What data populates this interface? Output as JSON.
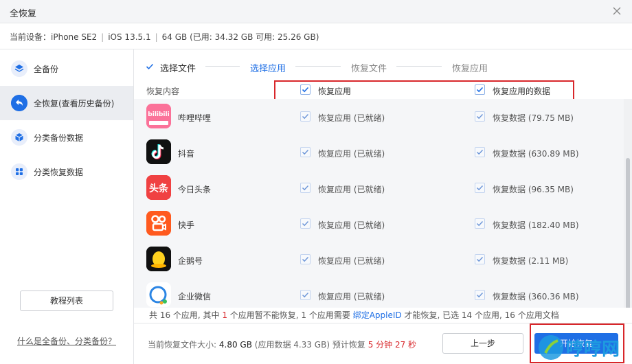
{
  "window": {
    "title": "全恢复"
  },
  "device": {
    "label": "当前设备：",
    "model": "iPhone SE2",
    "ios": "iOS 13.5.1",
    "storage": "64 GB (已用: 34.32 GB 可用: 25.26 GB)"
  },
  "sidebar": {
    "items": [
      {
        "label": "全备份",
        "icon": "layers-icon"
      },
      {
        "label": "全恢复(查看历史备份)",
        "icon": "restore-icon"
      },
      {
        "label": "分类备份数据",
        "icon": "cube-icon"
      },
      {
        "label": "分类恢复数据",
        "icon": "grid-icon"
      }
    ],
    "tutorial_button": "教程列表",
    "help_link": "什么是全备份、分类备份？"
  },
  "steps": [
    {
      "label": "选择文件",
      "state": "done"
    },
    {
      "label": "选择应用",
      "state": "current"
    },
    {
      "label": "恢复文件",
      "state": "todo"
    },
    {
      "label": "恢复应用",
      "state": "todo"
    }
  ],
  "table": {
    "header": {
      "content_label": "恢复内容",
      "col_app": "恢复应用",
      "col_data": "恢复应用的数据"
    },
    "rows": [
      {
        "name": "哔哩哔哩",
        "app_status": "恢复应用 (已就绪)",
        "data_status": "恢复数据 (79.75 MB)",
        "icon": "bilibili-icon"
      },
      {
        "name": "抖音",
        "app_status": "恢复应用 (已就绪)",
        "data_status": "恢复数据 (630.89 MB)",
        "icon": "douyin-icon"
      },
      {
        "name": "今日头条",
        "app_status": "恢复应用 (已就绪)",
        "data_status": "恢复数据 (96.35 MB)",
        "icon": "toutiao-icon"
      },
      {
        "name": "快手",
        "app_status": "恢复应用 (已就绪)",
        "data_status": "恢复数据 (182.40 MB)",
        "icon": "kuaishou-icon"
      },
      {
        "name": "企鹅号",
        "app_status": "恢复应用 (已就绪)",
        "data_status": "恢复数据 (2.11 MB)",
        "icon": "penguin-icon"
      },
      {
        "name": "企业微信",
        "app_status": "恢复应用 (已就绪)",
        "data_status": "恢复数据 (360.36 MB)",
        "icon": "wecom-icon"
      }
    ]
  },
  "summary": {
    "p1": "共 16 个应用, 其中 ",
    "n1": "1",
    "p2": " 个应用暂不能恢复, 1 个应用需要 ",
    "link": "绑定AppleID",
    "p3": " 才能恢复, 已选 14 个应用, 16 个应用文档"
  },
  "footer": {
    "size_label": "当前恢复文件大小:",
    "size_value": "4.80 GB",
    "size_detail": "(应用数据 4.33 GB)",
    "eta_label": "预计恢复",
    "eta_value": "5 分钟 27 秒",
    "prev_button": "上一步",
    "start_button": "开始恢复"
  },
  "watermark": {
    "text": "哼哼网"
  },
  "colors": {
    "accent": "#1f6fe5",
    "highlight_red": "#d8262a"
  }
}
